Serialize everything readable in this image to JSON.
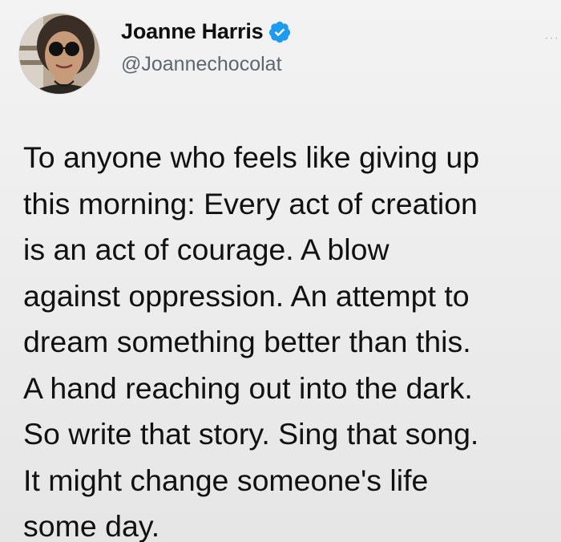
{
  "author": {
    "display_name": "Joanne Harris",
    "handle": "@Joannechocolat",
    "verified_icon": "verified-badge-icon",
    "avatar_icon": "profile-photo"
  },
  "more_glyph": "···",
  "tweet": {
    "lines": [
      "To anyone who feels like giving up",
      "this morning: Every act of creation",
      "is an act of courage. A blow",
      "against oppression. An attempt to",
      "dream something better than this.",
      "A hand reaching out into the dark.",
      "So write that story. Sing that song.",
      "It might change someone's life",
      "some day."
    ]
  },
  "colors": {
    "verified_blue": "#1d9bf0",
    "handle_gray": "#5f6670",
    "text": "#111111"
  }
}
